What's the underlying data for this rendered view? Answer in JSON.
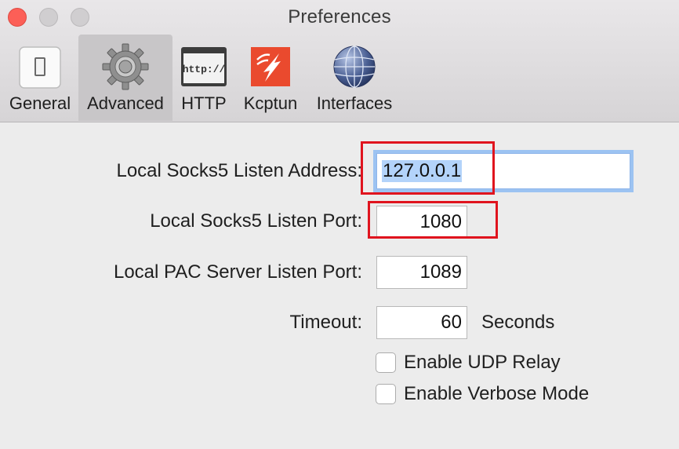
{
  "window": {
    "title": "Preferences"
  },
  "toolbar": {
    "tabs": [
      {
        "label": "General",
        "icon": "toggle-switch-icon",
        "selected": false
      },
      {
        "label": "Advanced",
        "icon": "gear-icon",
        "selected": true
      },
      {
        "label": "HTTP",
        "icon": "http-browser-icon",
        "selected": false
      },
      {
        "label": "Kcptun",
        "icon": "kcptun-lightning-icon",
        "selected": false
      },
      {
        "label": "Interfaces",
        "icon": "globe-network-icon",
        "selected": false
      }
    ]
  },
  "form": {
    "socks5_address": {
      "label": "Local Socks5 Listen Address:",
      "value": "127.0.0.1",
      "focused": true,
      "text_selected": true
    },
    "socks5_port": {
      "label": "Local Socks5 Listen Port:",
      "value": "1080"
    },
    "pac_port": {
      "label": "Local PAC Server Listen Port:",
      "value": "1089"
    },
    "timeout": {
      "label": "Timeout:",
      "value": "60",
      "unit": "Seconds"
    },
    "udp_relay": {
      "label": "Enable UDP Relay",
      "checked": false
    },
    "verbose_mode": {
      "label": "Enable Verbose Mode",
      "checked": false
    }
  },
  "colors": {
    "close_button": "#fc5f57",
    "focus_ring": "#9cc3f2",
    "text_selection": "#b3d3fa",
    "annotation_box": "#e0141e"
  }
}
